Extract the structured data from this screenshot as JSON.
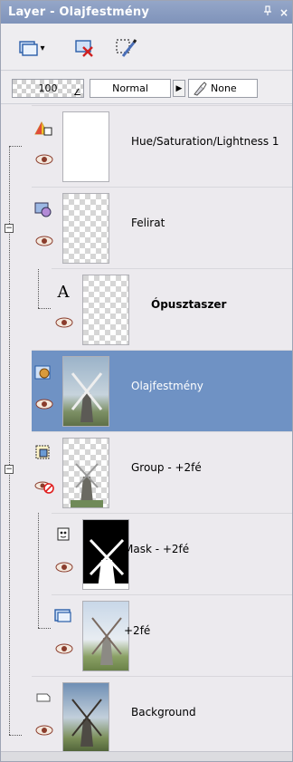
{
  "window": {
    "title": "Layer - Olajfestmény",
    "pin_label": "",
    "close_label": "×"
  },
  "toolbar": {
    "dropdown_arrow": "▾"
  },
  "properties": {
    "opacity": "100",
    "blend_mode": "Normal",
    "link_mode": "None"
  },
  "layers": [
    {
      "name": "Hue/Saturation/Lightness 1",
      "type": "adjustment",
      "visible": true
    },
    {
      "name": "Felirat",
      "type": "group",
      "visible": true
    },
    {
      "name": "Ópusztaszer",
      "type": "text",
      "visible": true
    },
    {
      "name": "Olajfestmény",
      "type": "raster",
      "visible": true,
      "selected": true
    },
    {
      "name": "Group - +2fé",
      "type": "group",
      "visible": false
    },
    {
      "name": "Mask - +2fé",
      "type": "mask",
      "visible": true
    },
    {
      "name": "+2fé",
      "type": "raster",
      "visible": true
    },
    {
      "name": "Background",
      "type": "background",
      "visible": true
    }
  ],
  "colors": {
    "selection": "#6f92c4",
    "titlebar": "#8b9dc0"
  }
}
